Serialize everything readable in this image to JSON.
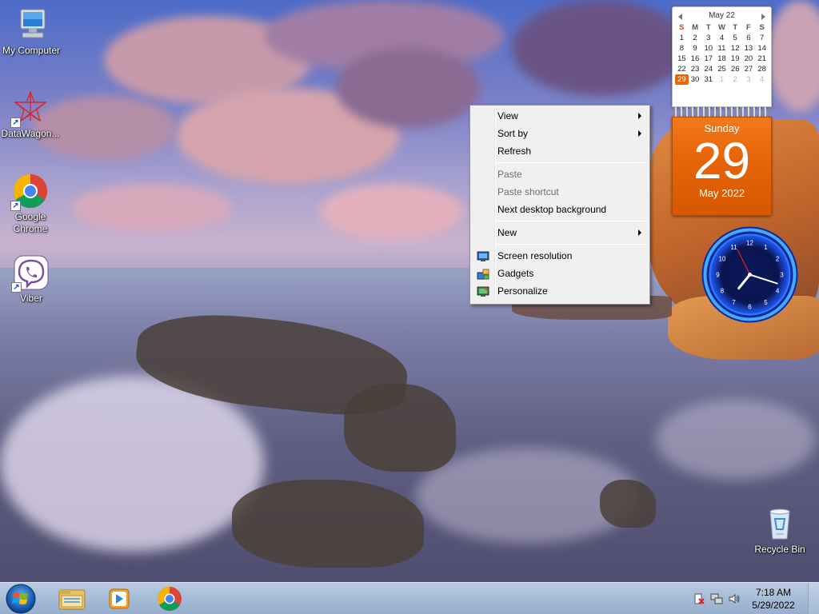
{
  "desktop_icons": [
    {
      "label": "My Computer",
      "icon": "computer-icon"
    },
    {
      "label": "DataWagon...",
      "icon": "datawagon-icon"
    },
    {
      "label": "Google Chrome",
      "icon": "chrome-icon"
    },
    {
      "label": "Viber",
      "icon": "viber-icon"
    },
    {
      "label": "Recycle Bin",
      "icon": "recycle-bin-icon"
    }
  ],
  "context_menu": {
    "view": "View",
    "sort_by": "Sort by",
    "refresh": "Refresh",
    "paste": "Paste",
    "paste_shortcut": "Paste shortcut",
    "next_background": "Next desktop background",
    "new": "New",
    "screen_resolution": "Screen resolution",
    "gadgets": "Gadgets",
    "personalize": "Personalize"
  },
  "calendar_gadget": {
    "month_title": "May 22",
    "weekday_headers": [
      "S",
      "M",
      "T",
      "W",
      "T",
      "F",
      "S"
    ],
    "weeks": [
      [
        "1",
        "2",
        "3",
        "4",
        "5",
        "6",
        "7"
      ],
      [
        "8",
        "9",
        "10",
        "11",
        "12",
        "13",
        "14"
      ],
      [
        "15",
        "16",
        "17",
        "18",
        "19",
        "20",
        "21"
      ],
      [
        "22",
        "23",
        "24",
        "25",
        "26",
        "27",
        "28"
      ],
      [
        "29",
        "30",
        "31",
        "1",
        "2",
        "3",
        "4"
      ]
    ],
    "today": "29",
    "weekday": "Sunday",
    "day_number": "29",
    "month_year": "May 2022"
  },
  "clock_gadget": {
    "numerals": [
      "12",
      "1",
      "2",
      "3",
      "4",
      "5",
      "6",
      "7",
      "8",
      "9",
      "10",
      "11"
    ],
    "time": "7:18"
  },
  "taskbar": {
    "pinned": [
      "explorer-icon",
      "media-player-icon",
      "chrome-icon"
    ],
    "tray_icons": [
      "action-center-icon",
      "network-icon",
      "volume-icon"
    ],
    "time": "7:18 AM",
    "date": "5/29/2022"
  },
  "colors": {
    "calendar_orange": "#e8660a",
    "clock_blue": "#1a4fd6",
    "menu_bg": "#f0f0f0"
  }
}
